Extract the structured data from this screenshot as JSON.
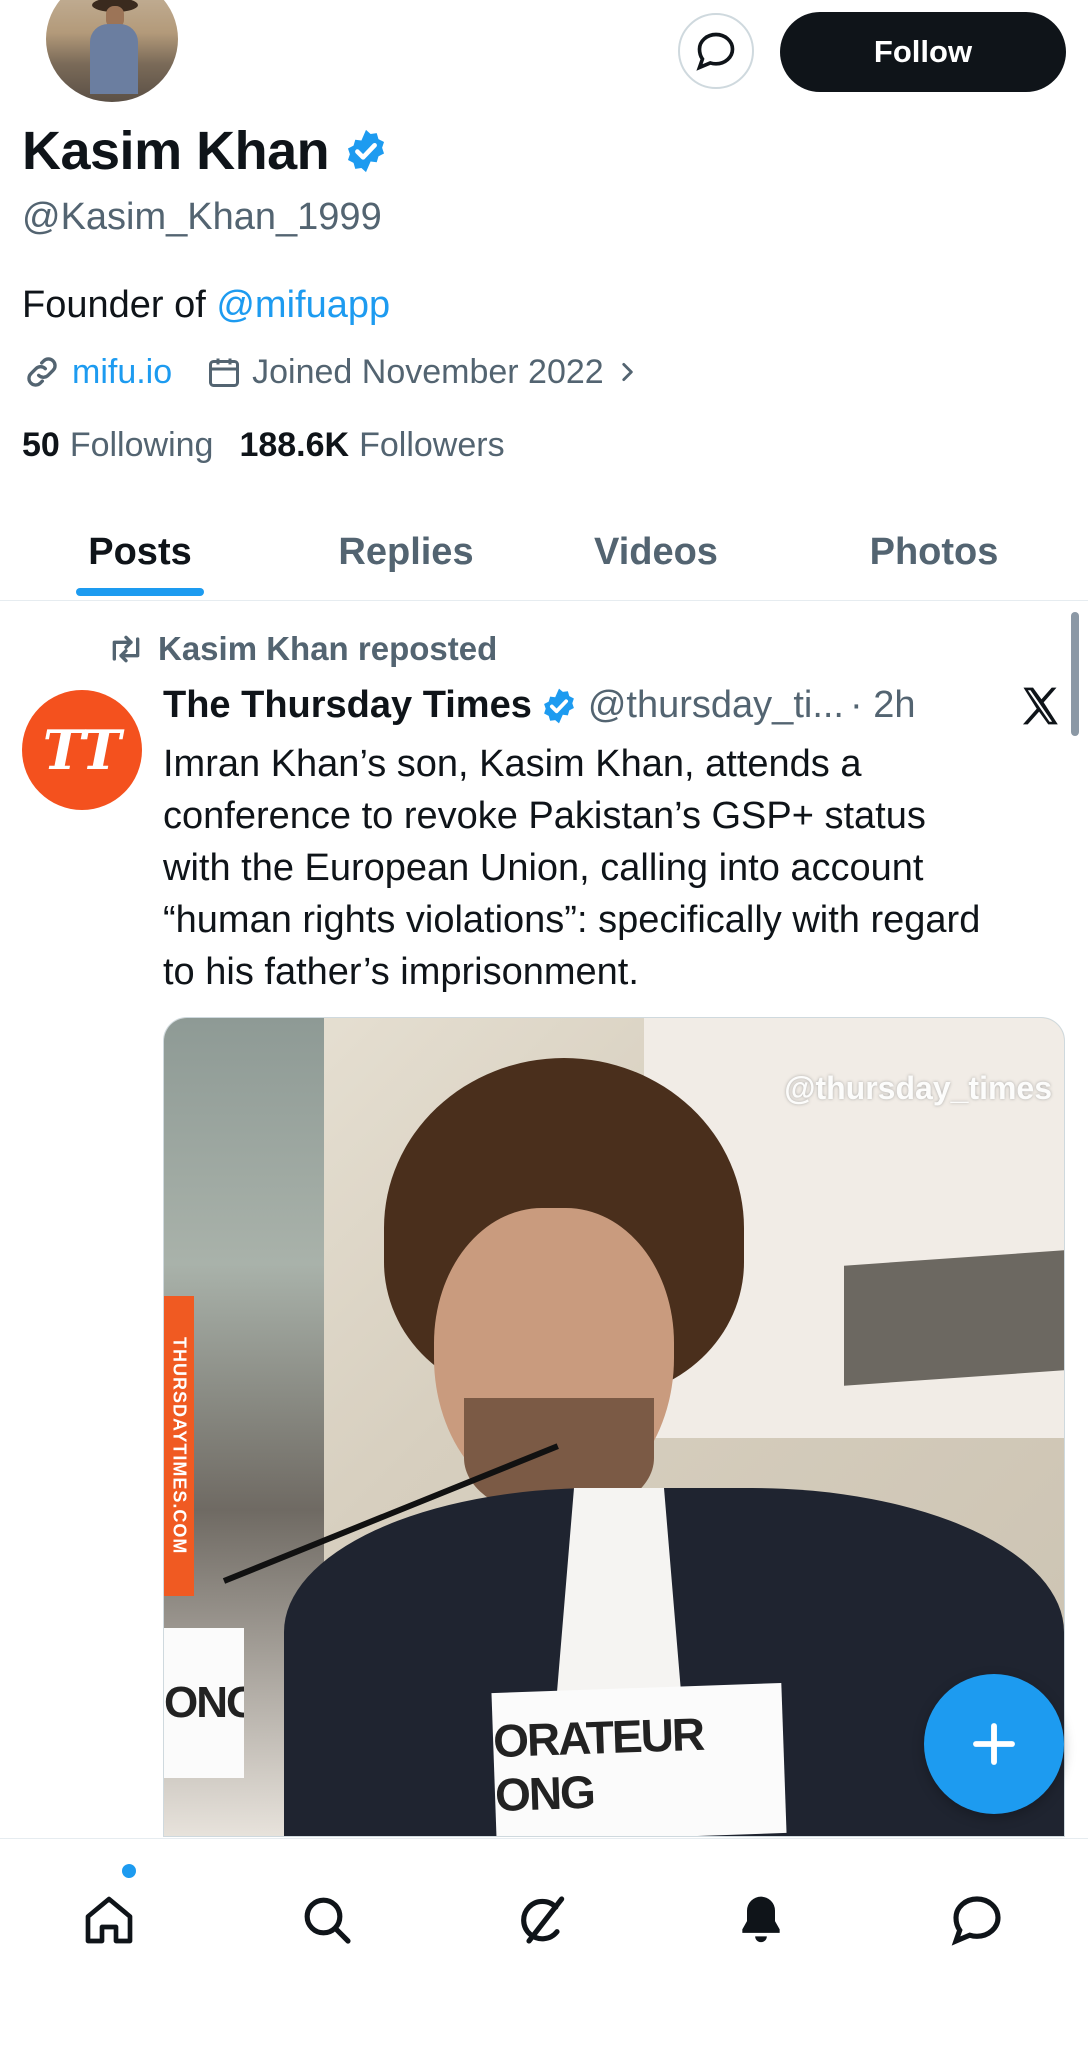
{
  "profile": {
    "name": "Kasim Khan",
    "handle": "@Kasim_Khan_1999",
    "bio_prefix": "Founder of ",
    "bio_mention": "@mifuapp",
    "website": "mifu.io",
    "joined": "Joined November 2022",
    "following_count": "50",
    "following_label": "Following",
    "followers_count": "188.6K",
    "followers_label": "Followers",
    "follow_button": "Follow"
  },
  "tabs": [
    {
      "label": "Posts",
      "active": true
    },
    {
      "label": "Replies",
      "active": false
    },
    {
      "label": "Videos",
      "active": false
    },
    {
      "label": "Photos",
      "active": false
    }
  ],
  "post": {
    "repost_label": "Kasim Khan reposted",
    "author_name": "The Thursday Times",
    "author_handle": "@thursday_ti...",
    "time": "· 2h",
    "avatar_text": "TT",
    "text_lines": [
      "Imran Khan’s son, Kasim Khan, attends a",
      "conference to revoke Pakistan’s GSP+ status",
      "with the European Union, calling into account",
      "“human rights violations”: specifically with regard",
      "to his father’s imprisonment."
    ],
    "media": {
      "watermark": "@thursday_times",
      "side_banner": "THURSDAYTIMES.COM",
      "sign_text": "ORATEUR ONG",
      "sign_left_text": "ONG"
    }
  },
  "colors": {
    "accent": "#1d9bf0",
    "text_primary": "#0f1419",
    "text_secondary": "#536471",
    "thursday_orange": "#f4511e"
  },
  "icons": {
    "message": "message-bubble-icon",
    "verified": "verified-badge-icon",
    "link": "link-icon",
    "calendar": "calendar-icon",
    "chevron": "chevron-right-icon",
    "repost": "repost-icon",
    "x_logo": "x-logo-icon",
    "compose": "plus-icon",
    "nav": [
      "home-icon",
      "search-icon",
      "grok-icon",
      "bell-icon",
      "chat-icon"
    ]
  }
}
